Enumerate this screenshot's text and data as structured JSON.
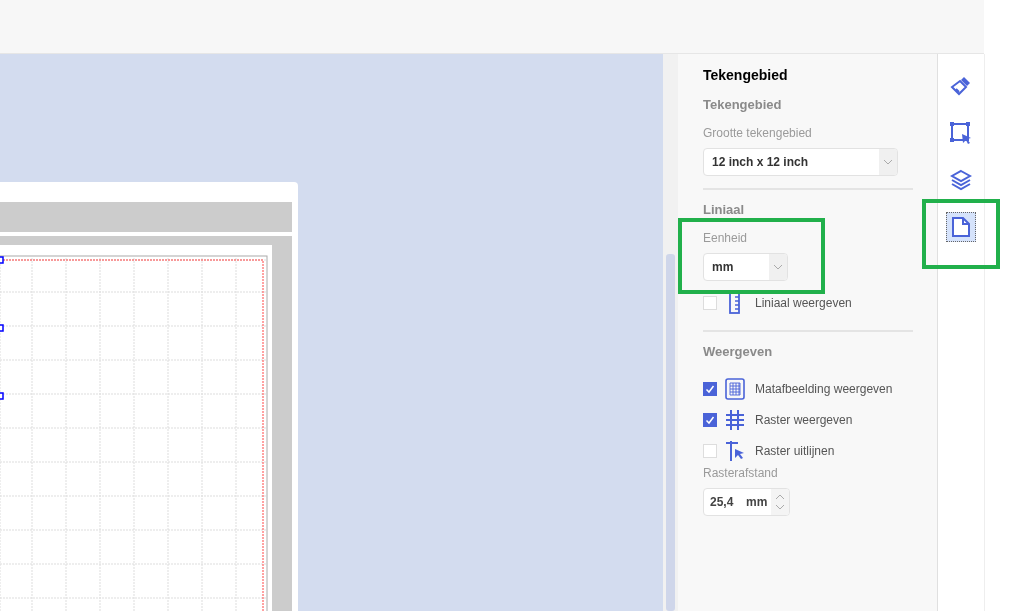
{
  "panel": {
    "title": "Tekengebied",
    "sections": [
      {
        "heading": "Tekengebied",
        "fields": [
          {
            "kind": "select",
            "label": "Grootte tekengebied",
            "value": "12 inch x 12 inch",
            "highlighted": false
          }
        ]
      },
      {
        "heading": "Liniaal",
        "fields": [
          {
            "kind": "select",
            "label": "Eenheid",
            "value": "mm",
            "highlighted": true
          },
          {
            "kind": "ruler",
            "label": "Liniaal weergeven",
            "checked": false
          }
        ]
      },
      {
        "heading": "Weergeven",
        "fields": [
          {
            "kind": "mat",
            "label": "Matafbeelding weergeven",
            "checked": true
          },
          {
            "kind": "grid",
            "label": "Raster weergeven",
            "checked": true
          },
          {
            "kind": "snap",
            "label": "Raster uitlijnen",
            "checked": false
          },
          {
            "kind": "number",
            "label": "Rasterafstand",
            "value": "25,4",
            "unit": "mm"
          }
        ]
      }
    ]
  },
  "rail": [
    {
      "kind": "brush",
      "selected": false,
      "highlighted": false
    },
    {
      "kind": "select",
      "selected": false,
      "highlighted": false
    },
    {
      "kind": "layers",
      "selected": false,
      "highlighted": false
    },
    {
      "kind": "page",
      "selected": true,
      "highlighted": true
    }
  ]
}
